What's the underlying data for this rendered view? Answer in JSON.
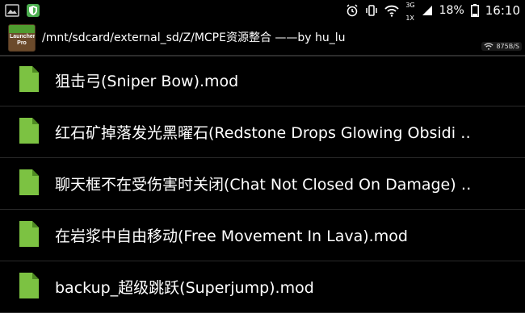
{
  "status_bar": {
    "left_icons": [
      "image-icon",
      "shield-icon"
    ],
    "network_top": "3G",
    "network_bottom": "1X",
    "battery": "18%",
    "time": "16:10"
  },
  "title_bar": {
    "app_icon_text": "Launcher Pro",
    "path": "/mnt/sdcard/external_sd/Z/MCPE资源整合 ——by hu_lu",
    "net_speed": "875B/S"
  },
  "files": [
    {
      "name": "狙击弓(Sniper Bow).mod"
    },
    {
      "name": "红石矿掉落发光黑曜石(Redstone Drops Glowing Obsidi ‥"
    },
    {
      "name": "聊天框不在受伤害时关闭(Chat Not Closed On Damage) ‥"
    },
    {
      "name": "在岩浆中自由移动(Free Movement In Lava).mod"
    },
    {
      "name": "backup_超级跳跃(Superjump).mod"
    }
  ],
  "colors": {
    "background": "#000000",
    "file_icon": "#7cc242",
    "divider": "#2a2a2a"
  }
}
